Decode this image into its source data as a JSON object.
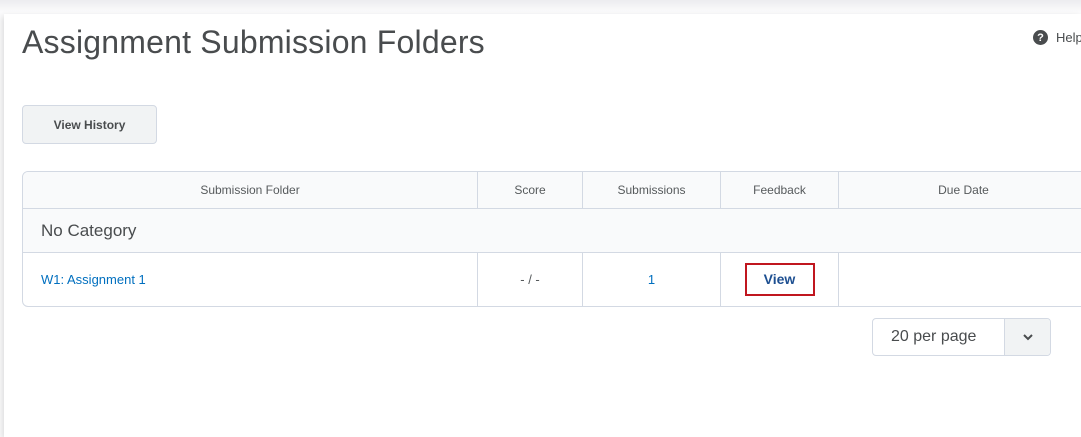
{
  "page": {
    "title": "Assignment Submission Folders",
    "help_label": "Help",
    "help_icon": "question-circle-icon"
  },
  "toolbar": {
    "view_history_label": "View History"
  },
  "table": {
    "columns": [
      "Submission Folder",
      "Score",
      "Submissions",
      "Feedback",
      "Due Date"
    ],
    "category": "No Category",
    "rows": [
      {
        "folder": "W1: Assignment 1",
        "score": "- / -",
        "submissions": "1",
        "feedback": "View",
        "due_date": ""
      }
    ]
  },
  "pagination": {
    "per_page": "20 per page",
    "chevron_icon": "chevron-down-icon"
  },
  "colors": {
    "link": "#006fbf",
    "highlight": "#c0161f",
    "text": "#494c4e"
  }
}
